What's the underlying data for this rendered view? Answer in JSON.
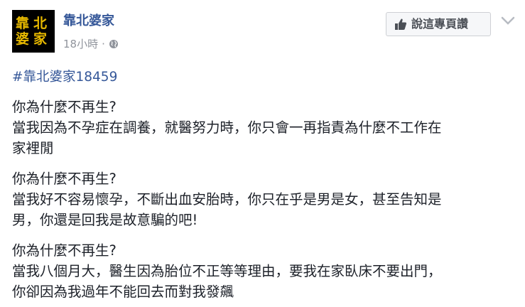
{
  "post": {
    "page_name": "靠北婆家",
    "avatar_text": [
      "靠北",
      "婆家"
    ],
    "timestamp": "18小時",
    "separator": "·",
    "privacy_icon": "globe-icon",
    "like_button_label": "說這專頁讚",
    "like_icon": "thumbs-up-icon",
    "menu_icon": "chevron-down-icon",
    "hashtag": "#靠北婆家18459",
    "paragraphs": [
      {
        "lines": [
          "你為什麼不再生?",
          "當我因為不孕症在調養，就醫努力時，你只會一再指責為什麼不工作在",
          "家裡閒"
        ]
      },
      {
        "lines": [
          "你為什麼不再生?",
          "當我好不容易懷孕，不斷出血安胎時，你只在乎是男是女，甚至告知是",
          "男，你還是回我是故意騙的吧!"
        ]
      },
      {
        "lines": [
          "你為什麼不再生?",
          "當我八個月大，醫生因為胎位不正等等理由，要我在家臥床不要出門，",
          "你卻因為我過年不能回去而對我發飆"
        ]
      }
    ]
  },
  "colors": {
    "link": "#365899",
    "text": "#1d2129",
    "meta": "#90949c",
    "avatar_bg": "#000000",
    "avatar_text": "#e6b800"
  }
}
